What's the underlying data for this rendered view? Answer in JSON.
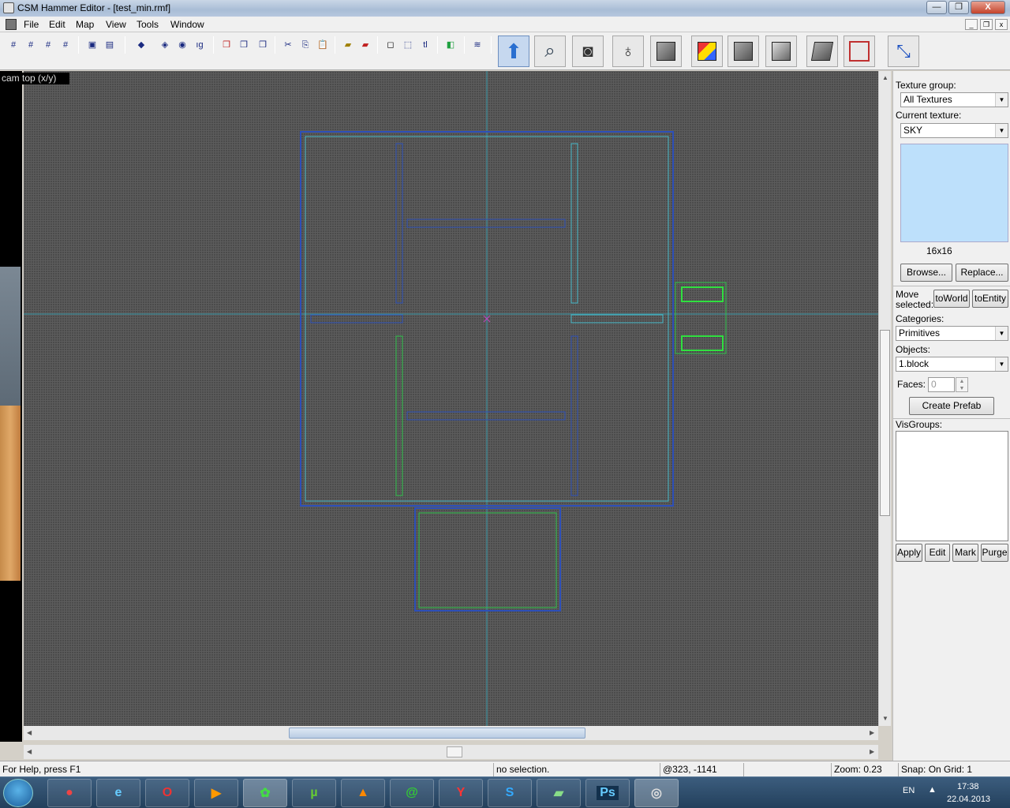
{
  "window": {
    "title": "CSM Hammer Editor - [test_min.rmf]",
    "min": "—",
    "max": "❐",
    "close": "X"
  },
  "menu": [
    "File",
    "Edit",
    "Map",
    "View",
    "Tools",
    "Window"
  ],
  "mdi_buttons": [
    "_",
    "❐",
    "x"
  ],
  "toolbar_icons": [
    "grid-icon",
    "grid-3d-icon",
    "grid-smaller-icon",
    "grid-larger-icon",
    "group-icon",
    "ungroup-icon",
    "carve-icon",
    "hollow-icon",
    "hide-icon",
    "show-icon",
    "cut-icon",
    "copy-icon",
    "paste-icon",
    "texture-lock-icon",
    "texture-app-icon",
    "select-icon",
    "rotate-icon",
    "text-icon",
    "flip-icon",
    "run-icon"
  ],
  "tools": [
    "selection-tool-icon",
    "magnify-tool-icon",
    "camera-tool-icon",
    "entity-tool-icon",
    "block-tool-icon",
    "texture-app-tool-icon",
    "apply-texture-tool-icon",
    "decal-tool-icon",
    "clip-tool-icon",
    "vertex-tool-icon",
    "path-tool-icon"
  ],
  "view": {
    "label": "cam top (x/y)"
  },
  "panel": {
    "texture_group_label": "Texture group:",
    "texture_group_value": "All Textures",
    "current_texture_label": "Current texture:",
    "current_texture_value": "SKY",
    "texture_size": "16x16",
    "browse": "Browse...",
    "replace": "Replace...",
    "move_selected_line1": "Move",
    "move_selected_line2": "selected:",
    "to_world": "toWorld",
    "to_entity": "toEntity",
    "categories_label": "Categories:",
    "categories_value": "Primitives",
    "objects_label": "Objects:",
    "objects_value": "1.block",
    "faces_label": "Faces:",
    "faces_value": "0",
    "create_prefab": "Create Prefab",
    "visgroups_label": "VisGroups:",
    "apply": "Apply",
    "edit": "Edit",
    "mark": "Mark",
    "purge": "Purge"
  },
  "status": {
    "help": "For Help, press F1",
    "selection": "no selection.",
    "coords": "@323, -1141",
    "zoom": "Zoom: 0.23",
    "snap": "Snap: On Grid: 1"
  },
  "taskbar": {
    "apps": [
      "chrome-icon",
      "ie-icon",
      "opera-icon",
      "media-player-icon",
      "icq-icon",
      "utorrent-icon",
      "vlc-icon",
      "mail-agent-icon",
      "yandex-icon",
      "skype-icon",
      "editor-icon",
      "photoshop-icon",
      "hammer-icon"
    ],
    "ps_label": "Ps",
    "lang": "EN",
    "time": "17:38",
    "date": "22.04.2013"
  },
  "colors": {
    "accent": "#6d8fbf",
    "brush_blue": "#2d4fb8",
    "brush_cyan": "#46b8c8",
    "brush_green": "#2ec04a",
    "sky": "#bde0fb"
  }
}
